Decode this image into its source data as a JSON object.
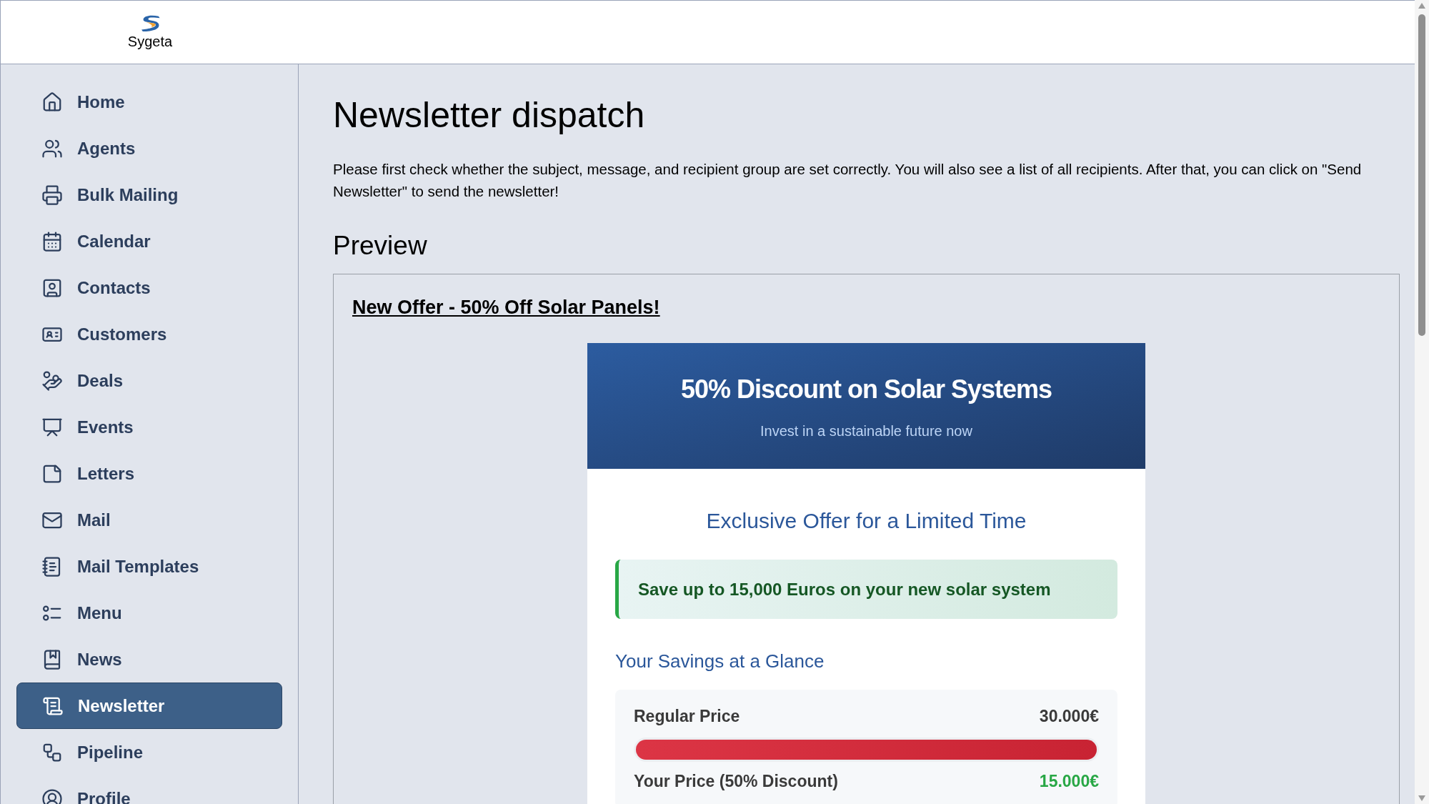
{
  "brand": {
    "name": "Sygeta"
  },
  "sidebar": {
    "items": [
      {
        "label": "Home",
        "selected": false
      },
      {
        "label": "Agents",
        "selected": false
      },
      {
        "label": "Bulk Mailing",
        "selected": false
      },
      {
        "label": "Calendar",
        "selected": false
      },
      {
        "label": "Contacts",
        "selected": false
      },
      {
        "label": "Customers",
        "selected": false
      },
      {
        "label": "Deals",
        "selected": false
      },
      {
        "label": "Events",
        "selected": false
      },
      {
        "label": "Letters",
        "selected": false
      },
      {
        "label": "Mail",
        "selected": false
      },
      {
        "label": "Mail Templates",
        "selected": false
      },
      {
        "label": "Menu",
        "selected": false
      },
      {
        "label": "News",
        "selected": false
      },
      {
        "label": "Newsletter",
        "selected": true
      },
      {
        "label": "Pipeline",
        "selected": false
      },
      {
        "label": "Profile",
        "selected": false
      }
    ]
  },
  "page": {
    "title": "Newsletter dispatch",
    "intro": "Please first check whether the subject, message, and recipient group are set correctly. You will also see a list of all recipients. After that, you can click on \"Send Newsletter\" to send the newsletter!",
    "preview_heading": "Preview"
  },
  "preview": {
    "subject": "New Offer - 50% Off Solar Panels!",
    "email": {
      "headline": "50% Discount on Solar Systems",
      "tagline": "Invest in a sustainable future now",
      "offer_heading": "Exclusive Offer for a Limited Time",
      "highlight": "Save up to 15,000 Euros on your new solar system",
      "savings_heading": "Your Savings at a Glance",
      "prices": [
        {
          "kind": "regular",
          "label": "Regular Price",
          "amount": "30.000€",
          "level": 1
        },
        {
          "kind": "discount",
          "label": "Your Price (50% Discount)",
          "amount": "15.000€"
        }
      ]
    }
  }
}
